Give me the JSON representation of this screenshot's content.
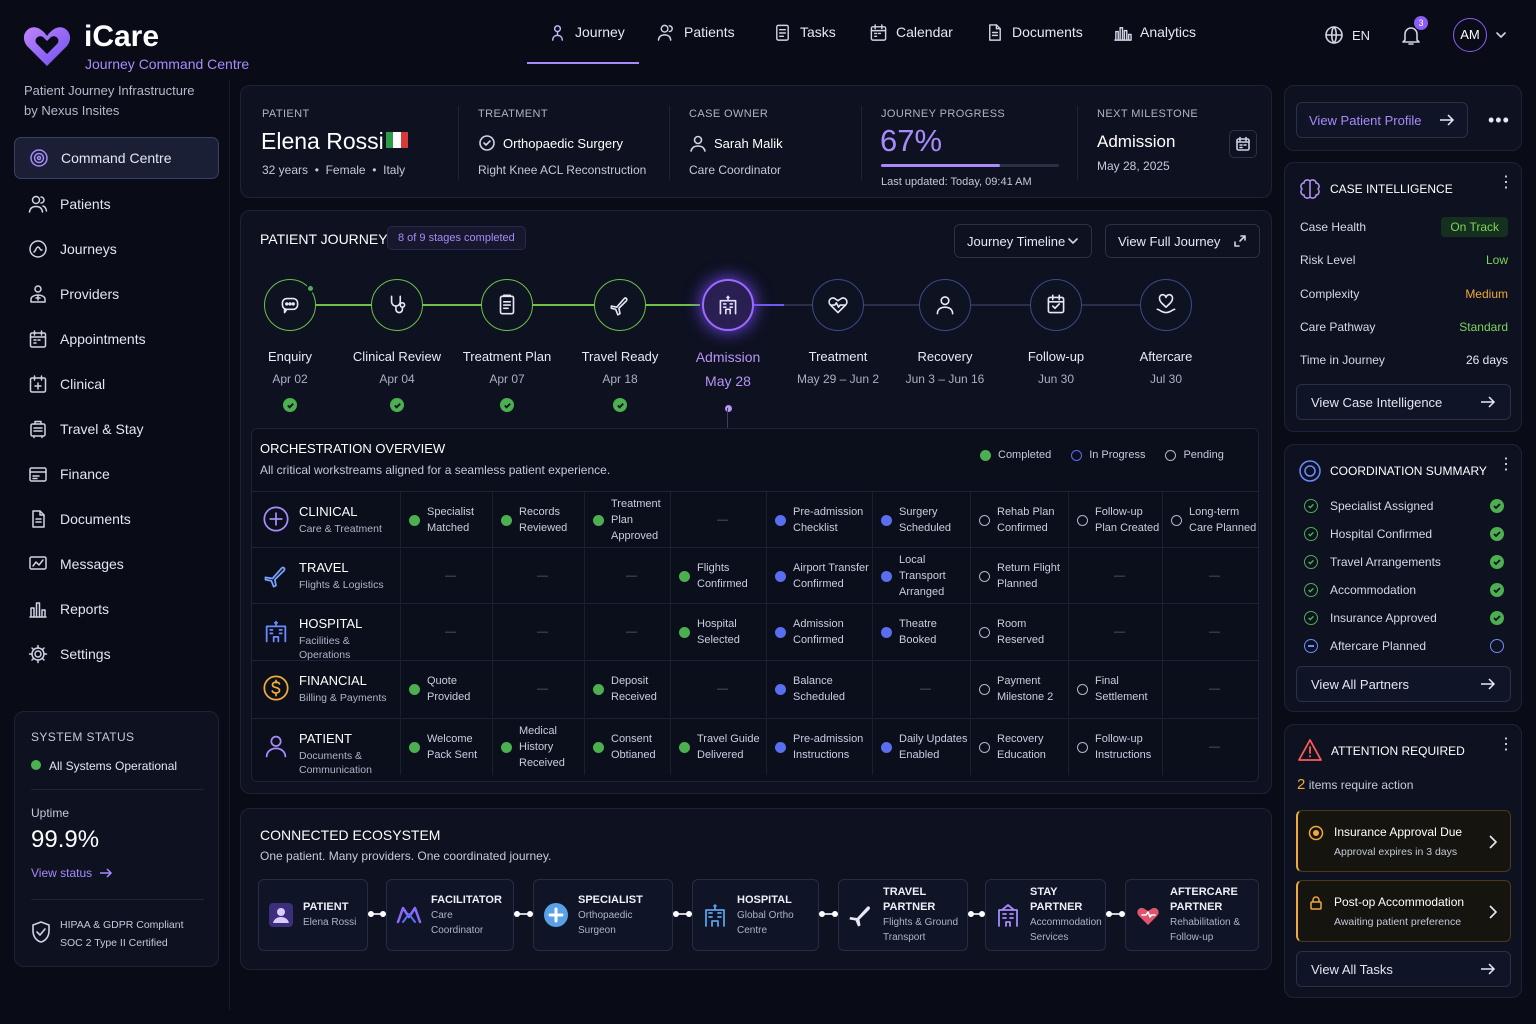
{
  "brand": {
    "name": "iCare",
    "subtitle": "Journey Command Centre",
    "tagline_1": "Patient Journey Infrastructure",
    "tagline_2": "by Nexus Insites"
  },
  "sidebar": {
    "items": [
      {
        "label": "Command Centre",
        "icon": "target-icon"
      },
      {
        "label": "Patients",
        "icon": "users-icon"
      },
      {
        "label": "Journeys",
        "icon": "route-icon"
      },
      {
        "label": "Providers",
        "icon": "provider-icon"
      },
      {
        "label": "Appointments",
        "icon": "calendar-icon"
      },
      {
        "label": "Clinical",
        "icon": "clinical-icon"
      },
      {
        "label": "Travel & Stay",
        "icon": "luggage-icon"
      },
      {
        "label": "Finance",
        "icon": "finance-icon"
      },
      {
        "label": "Documents",
        "icon": "document-icon"
      },
      {
        "label": "Messages",
        "icon": "message-icon"
      },
      {
        "label": "Reports",
        "icon": "reports-icon"
      },
      {
        "label": "Settings",
        "icon": "gear-icon"
      }
    ]
  },
  "system": {
    "title": "SYSTEM STATUS",
    "status": "All Systems Operational",
    "uptime_label": "Uptime",
    "uptime": "99.9%",
    "view_status": "View status",
    "compliance_1": "HIPAA & GDPR Compliant",
    "compliance_2": "SOC 2 Type II Certified"
  },
  "topnav": {
    "items": [
      "Journey",
      "Patients",
      "Tasks",
      "Calendar",
      "Documents",
      "Analytics"
    ],
    "lang": "EN",
    "notif_count": "3",
    "avatar": "AM"
  },
  "summary": {
    "patient_label": "PATIENT",
    "patient_name": "Elena Rossi",
    "age": "32 years",
    "gender": "Female",
    "country": "Italy",
    "treatment_label": "TREATMENT",
    "treatment": "Orthopaedic Surgery",
    "procedure": "Right Knee ACL Reconstruction",
    "owner_label": "CASE OWNER",
    "owner": "Sarah Malik",
    "owner_role": "Care Coordinator",
    "progress_label": "JOURNEY PROGRESS",
    "progress": "67%",
    "progress_value": 0.67,
    "updated": "Last updated: Today, 09:41 AM",
    "milestone_label": "NEXT MILESTONE",
    "milestone": "Admission",
    "milestone_date": "May 28, 2025"
  },
  "journey": {
    "title": "PATIENT JOURNEY",
    "badge": "8 of 9 stages completed",
    "timeline_btn": "Journey Timeline",
    "full_btn": "View Full Journey",
    "stages": [
      {
        "name": "Enquiry",
        "date": "Apr 02",
        "status": "done"
      },
      {
        "name": "Clinical Review",
        "date": "Apr 04",
        "status": "done"
      },
      {
        "name": "Treatment Plan",
        "date": "Apr 07",
        "status": "done"
      },
      {
        "name": "Travel Ready",
        "date": "Apr 18",
        "status": "done"
      },
      {
        "name": "Admission",
        "date": "May 28",
        "status": "active"
      },
      {
        "name": "Treatment",
        "date": "May 29 – Jun 2",
        "status": "pending"
      },
      {
        "name": "Recovery",
        "date": "Jun 3 – Jun 16",
        "status": "pending"
      },
      {
        "name": "Follow-up",
        "date": "Jun 30",
        "status": "pending"
      },
      {
        "name": "Aftercare",
        "date": "Jul 30",
        "status": "pending"
      }
    ]
  },
  "orchestration": {
    "title": "ORCHESTRATION OVERVIEW",
    "subtitle": "All critical workstreams aligned for a seamless patient experience.",
    "legend": {
      "completed": "Completed",
      "in_progress": "In Progress",
      "pending": "Pending"
    },
    "rows": [
      {
        "title": "CLINICAL",
        "sub": "Care & Treatment",
        "cells": [
          [
            "c",
            "Specialist Matched"
          ],
          [
            "c",
            "Records Reviewed"
          ],
          [
            "c",
            "Treatment Plan Approved"
          ],
          [
            "-",
            "—"
          ],
          [
            "p",
            "Pre-admission Checklist"
          ],
          [
            "p",
            "Surgery Scheduled"
          ],
          [
            "n",
            "Rehab Plan Confirmed"
          ],
          [
            "n",
            "Follow-up Plan Created"
          ],
          [
            "n",
            "Long-term Care Planned"
          ]
        ]
      },
      {
        "title": "TRAVEL",
        "sub": "Flights & Logistics",
        "cells": [
          [
            "-",
            "—"
          ],
          [
            "-",
            "—"
          ],
          [
            "-",
            "—"
          ],
          [
            "c",
            "Flights Confirmed"
          ],
          [
            "p",
            "Airport Transfer Confirmed"
          ],
          [
            "p",
            "Local Transport Arranged"
          ],
          [
            "n",
            "Return Flight Planned"
          ],
          [
            "-",
            "—"
          ],
          [
            "-",
            "—"
          ]
        ]
      },
      {
        "title": "HOSPITAL",
        "sub": "Facilities & Operations",
        "cells": [
          [
            "-",
            "—"
          ],
          [
            "-",
            "—"
          ],
          [
            "-",
            "—"
          ],
          [
            "c",
            "Hospital Selected"
          ],
          [
            "p",
            "Admission Confirmed"
          ],
          [
            "p",
            "Theatre Booked"
          ],
          [
            "n",
            "Room Reserved"
          ],
          [
            "-",
            "—"
          ],
          [
            "-",
            "—"
          ]
        ]
      },
      {
        "title": "FINANCIAL",
        "sub": "Billing & Payments",
        "cells": [
          [
            "c",
            "Quote Provided"
          ],
          [
            "-",
            "—"
          ],
          [
            "c",
            "Deposit Received"
          ],
          [
            "-",
            "—"
          ],
          [
            "p",
            "Balance Scheduled"
          ],
          [
            "-",
            "—"
          ],
          [
            "n",
            "Payment Milestone 2"
          ],
          [
            "n",
            "Final Settlement"
          ],
          [
            "-",
            "—"
          ]
        ]
      },
      {
        "title": "PATIENT",
        "sub": "Documents & Communication",
        "cells": [
          [
            "c",
            "Welcome Pack Sent"
          ],
          [
            "c",
            "Medical History Received"
          ],
          [
            "c",
            "Consent Obtianed"
          ],
          [
            "c",
            "Travel Guide Delivered"
          ],
          [
            "p",
            "Pre-admission Instructions"
          ],
          [
            "p",
            "Daily Updates Enabled"
          ],
          [
            "n",
            "Recovery Education"
          ],
          [
            "n",
            "Follow-up Instructions"
          ],
          [
            "-",
            "—"
          ]
        ]
      }
    ]
  },
  "ecosystem": {
    "title": "CONNECTED ECOSYSTEM",
    "subtitle": "One patient. Many providers. One coordinated journey.",
    "nodes": [
      {
        "title": "PATIENT",
        "sub": "Elena Rossi"
      },
      {
        "title": "FACILITATOR",
        "sub": "Care Coordinator"
      },
      {
        "title": "SPECIALIST",
        "sub": "Orthopaedic Surgeon"
      },
      {
        "title": "HOSPITAL",
        "sub": "Global Ortho Centre"
      },
      {
        "title": "TRAVEL PARTNER",
        "sub": "Flights & Ground Transport"
      },
      {
        "title": "STAY PARTNER",
        "sub": "Accommodation Services"
      },
      {
        "title": "AFTERCARE PARTNER",
        "sub": "Rehabilitation & Follow-up"
      }
    ]
  },
  "right": {
    "view_profile": "View Patient Profile",
    "intel": {
      "title": "CASE INTELLIGENCE",
      "rows": [
        {
          "k": "Case Health",
          "v": "On Track",
          "color": "#7fd35a"
        },
        {
          "k": "Risk Level",
          "v": "Low",
          "color": "#7fd35a"
        },
        {
          "k": "Complexity",
          "v": "Medium",
          "color": "#f0a93a"
        },
        {
          "k": "Care Pathway",
          "v": "Standard",
          "color": "#7fd35a"
        },
        {
          "k": "Time in Journey",
          "v": "26 days",
          "color": "#e6e9f5"
        }
      ],
      "button": "View Case Intelligence"
    },
    "coord": {
      "title": "COORDINATION SUMMARY",
      "items": [
        {
          "label": "Specialist Assigned",
          "done": true
        },
        {
          "label": "Hospital Confirmed",
          "done": true
        },
        {
          "label": "Travel Arrangements",
          "done": true
        },
        {
          "label": "Accommodation",
          "done": true
        },
        {
          "label": "Insurance Approved",
          "done": true
        },
        {
          "label": "Aftercare Planned",
          "done": false
        }
      ],
      "button": "View All Partners"
    },
    "attention": {
      "title": "ATTENTION REQUIRED",
      "count": "2",
      "count_text": "items require action",
      "items": [
        {
          "title": "Insurance Approval Due",
          "sub": "Approval expires in 3 days"
        },
        {
          "title": "Post-op Accommodation",
          "sub": "Awaiting patient preference"
        }
      ],
      "button": "View All Tasks"
    }
  },
  "colors": {
    "accent": "#8b5cf6",
    "green": "#4caf50",
    "blue": "#5a6ff0",
    "orange": "#f0a93a",
    "bg": "#090c17"
  }
}
